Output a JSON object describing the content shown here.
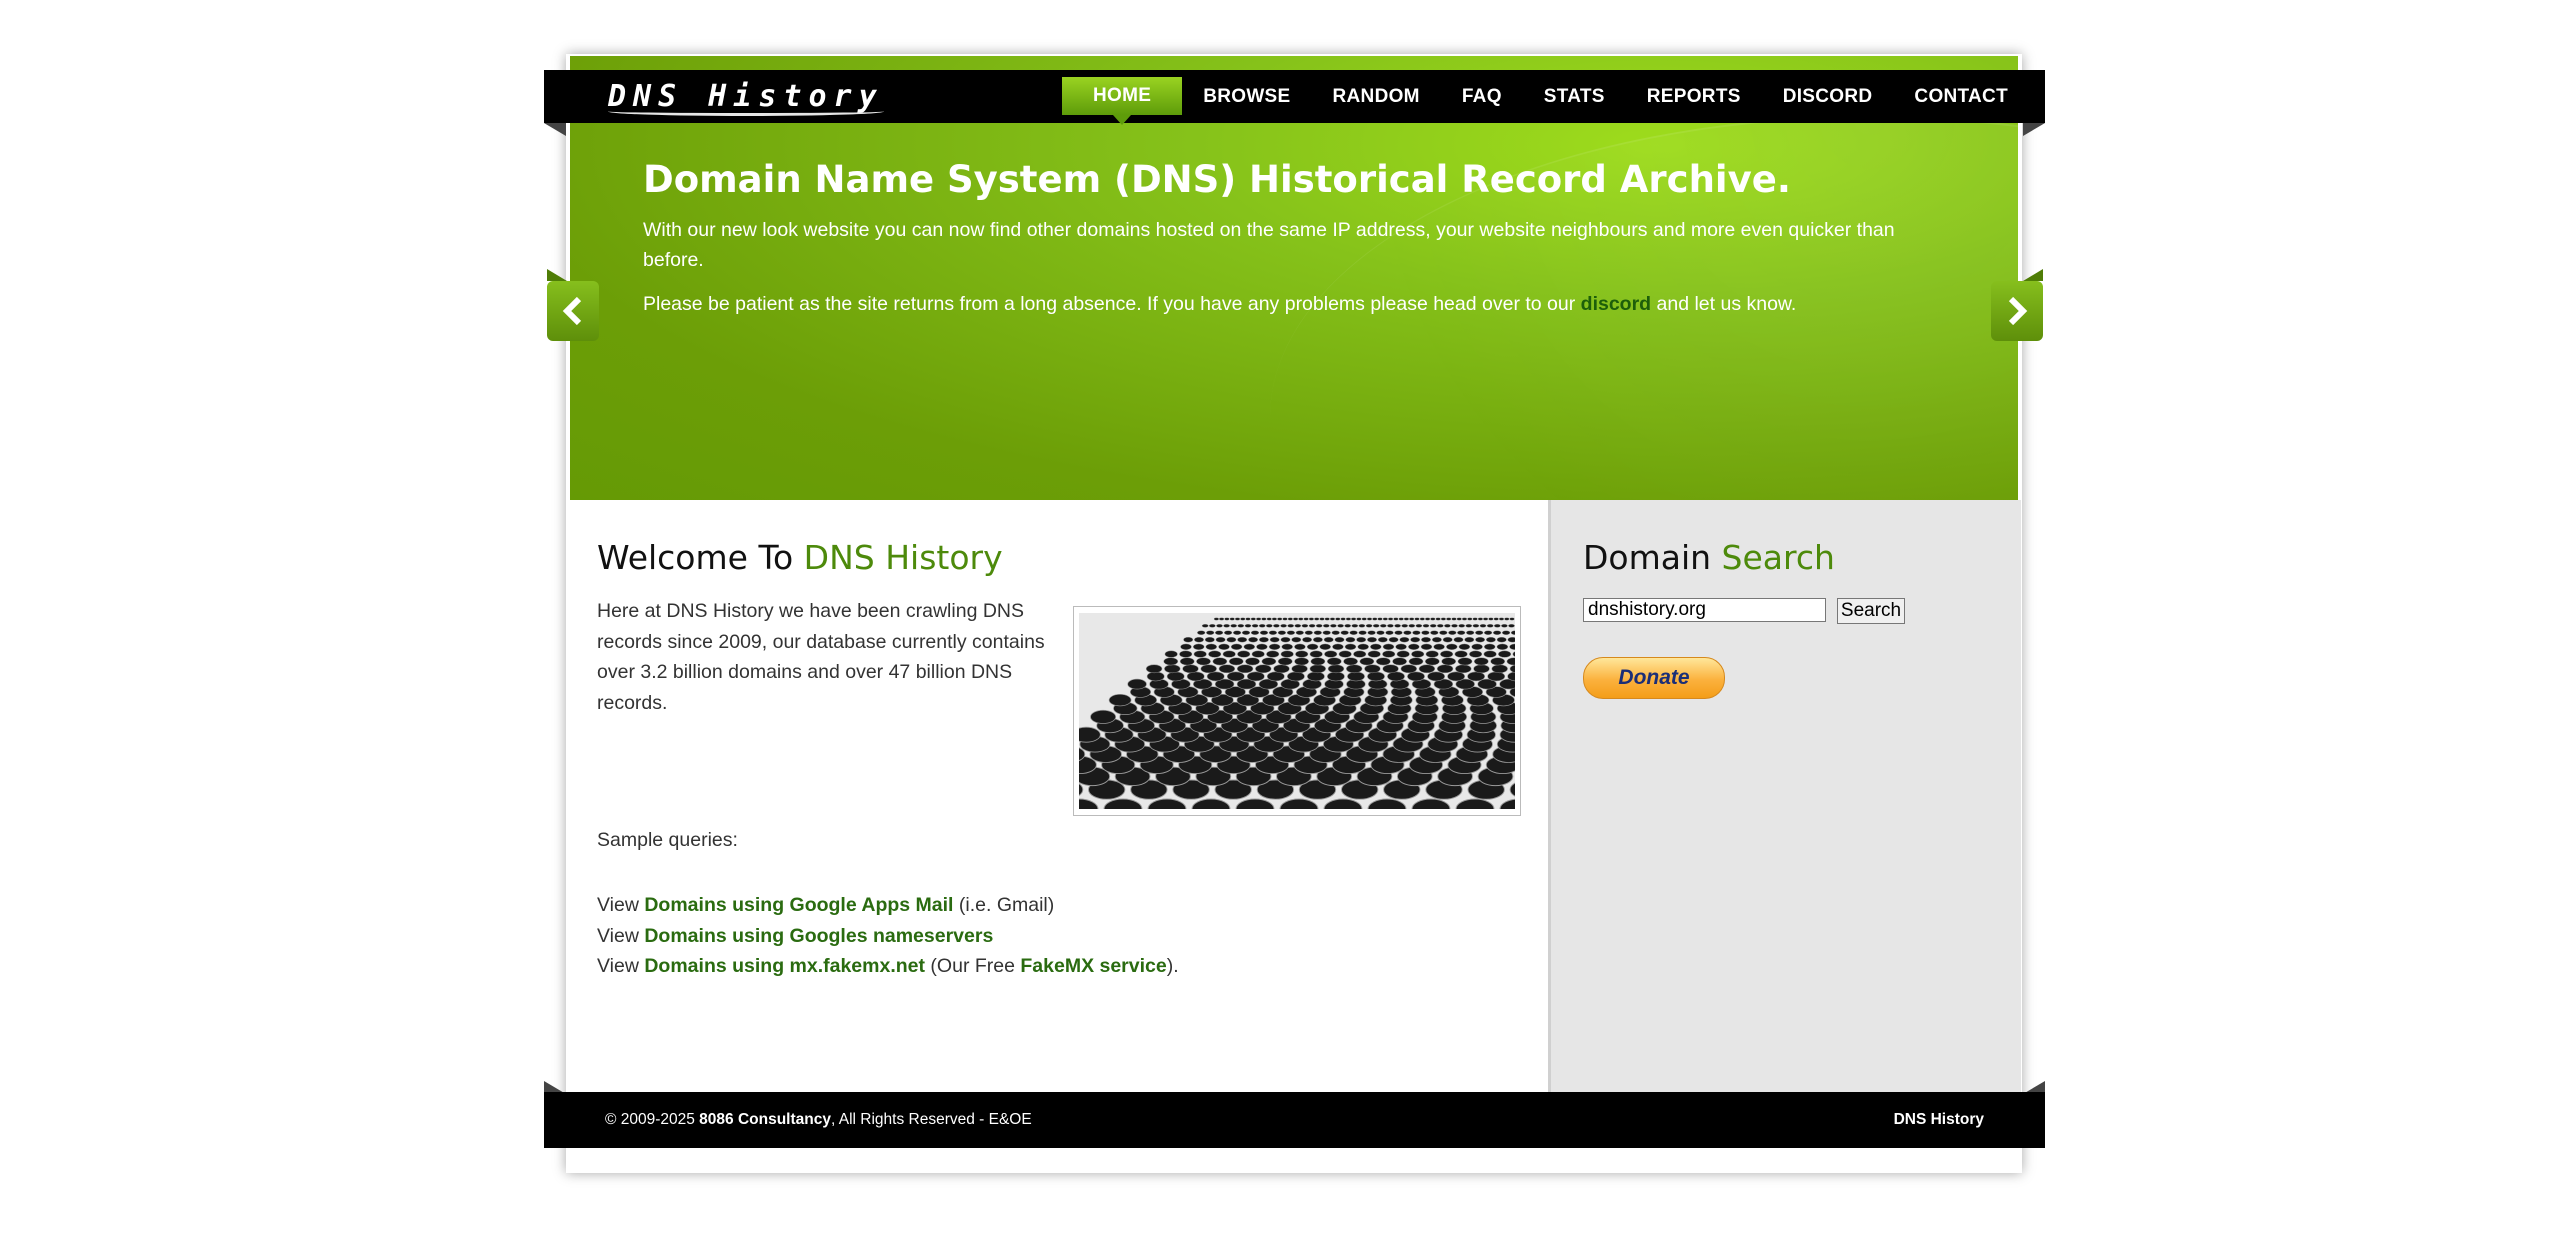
{
  "header": {
    "logo_text": "DNS History",
    "nav": [
      {
        "label": "HOME",
        "active": true
      },
      {
        "label": "BROWSE"
      },
      {
        "label": "RANDOM"
      },
      {
        "label": "FAQ"
      },
      {
        "label": "STATS"
      },
      {
        "label": "REPORTS"
      },
      {
        "label": "DISCORD"
      },
      {
        "label": "CONTACT"
      }
    ]
  },
  "hero": {
    "title": "Domain Name System (DNS) Historical Record Archive.",
    "paragraph1": "With our new look website you can now find other domains hosted on the same IP address, your website neighbours and more even quicker than before.",
    "paragraph2_before": "Please be patient as the site returns from a long absence. If you have any problems please head over to our ",
    "paragraph2_link": "discord",
    "paragraph2_after": " and let us know.",
    "prev_icon": "chevron-left-icon",
    "next_icon": "chevron-right-icon"
  },
  "main": {
    "heading_plain": "Welcome To ",
    "heading_accent": "DNS History",
    "intro": "Here at DNS History we have been crawling DNS records since 2009, our database currently contains over 3.2 billion domains and over 47 billion DNS records.",
    "sample_label": "Sample queries:",
    "queries": [
      {
        "prefix": "View ",
        "link": "Domains using Google Apps Mail",
        "suffix": " (i.e. Gmail)"
      },
      {
        "prefix": "View ",
        "link": "Domains using Googles nameservers",
        "suffix": ""
      },
      {
        "prefix": "View ",
        "link": "Domains using mx.fakemx.net",
        "suffix_before": " (Our Free ",
        "link2": "FakeMX service",
        "suffix_after": ")."
      }
    ]
  },
  "sidebar": {
    "heading_plain": "Domain ",
    "heading_accent": "Search",
    "search_value": "dnshistory.org",
    "search_button": "Search",
    "donate_label": "Donate"
  },
  "footer": {
    "copyright_prefix": "© 2009-2025 ",
    "company": "8086 Consultancy",
    "copyright_suffix": ", All Rights Reserved - E&OE",
    "right_text": "DNS History"
  },
  "colors": {
    "accent_green": "#4d8a0b",
    "hero_green": "#86c21a",
    "link_green": "#2a6b10",
    "nav_bg": "#000000"
  }
}
